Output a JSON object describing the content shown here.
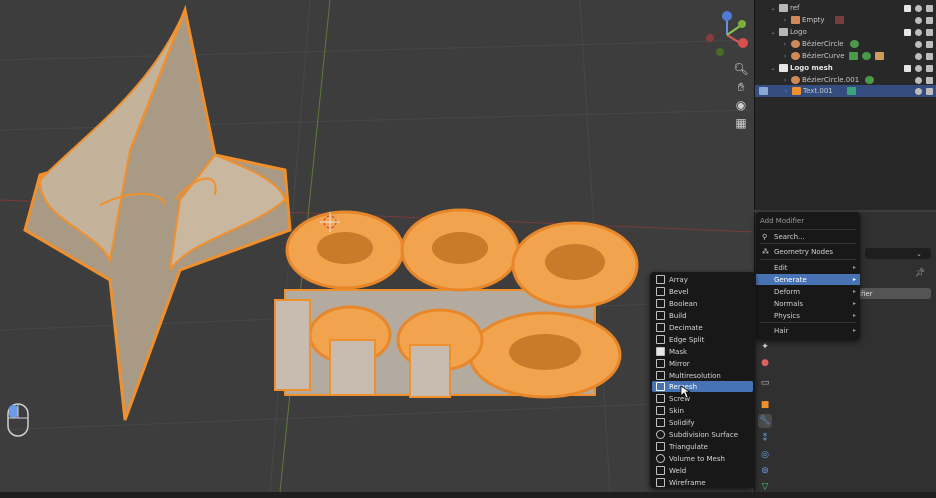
{
  "outliner": {
    "rows": [
      {
        "label": "ref",
        "indent": 0,
        "type": "collection",
        "bold": false,
        "selected": false
      },
      {
        "label": "Empty",
        "indent": 1,
        "type": "empty",
        "bold": false,
        "selected": false
      },
      {
        "label": "Logo",
        "indent": 0,
        "type": "collection",
        "bold": false,
        "selected": false
      },
      {
        "label": "BézierCircle",
        "indent": 1,
        "type": "curve",
        "bold": false,
        "selected": false
      },
      {
        "label": "BézierCurve",
        "indent": 1,
        "type": "curve",
        "bold": false,
        "selected": false
      },
      {
        "label": "Logo mesh",
        "indent": 0,
        "type": "collection",
        "bold": true,
        "selected": false
      },
      {
        "label": "BézierCircle.001",
        "indent": 1,
        "type": "curve",
        "bold": false,
        "selected": false
      },
      {
        "label": "Text.001",
        "indent": 1,
        "type": "text",
        "bold": false,
        "selected": true
      }
    ]
  },
  "add_modifier_menu": {
    "title": "Add Modifier",
    "search_label": "Search...",
    "geometry_nodes_label": "Geometry Nodes",
    "categories": [
      {
        "label": "Edit",
        "highlighted": false
      },
      {
        "label": "Generate",
        "highlighted": true
      },
      {
        "label": "Deform",
        "highlighted": false
      },
      {
        "label": "Normals",
        "highlighted": false
      },
      {
        "label": "Physics",
        "highlighted": false
      },
      {
        "label": "Hair",
        "highlighted": false
      }
    ]
  },
  "generate_menu": {
    "items": [
      {
        "label": "Array",
        "icon": "array-icon",
        "highlighted": false
      },
      {
        "label": "Bevel",
        "icon": "bevel-icon",
        "highlighted": false
      },
      {
        "label": "Boolean",
        "icon": "boolean-icon",
        "highlighted": false
      },
      {
        "label": "Build",
        "icon": "build-icon",
        "highlighted": false
      },
      {
        "label": "Decimate",
        "icon": "decimate-icon",
        "highlighted": false
      },
      {
        "label": "Edge Split",
        "icon": "edge-split-icon",
        "highlighted": false
      },
      {
        "label": "Mask",
        "icon": "mask-icon",
        "highlighted": false
      },
      {
        "label": "Mirror",
        "icon": "mirror-icon",
        "highlighted": false
      },
      {
        "label": "Multiresolution",
        "icon": "multires-icon",
        "highlighted": false
      },
      {
        "label": "Remesh",
        "icon": "remesh-icon",
        "highlighted": true
      },
      {
        "label": "Screw",
        "icon": "screw-icon",
        "highlighted": false
      },
      {
        "label": "Skin",
        "icon": "skin-icon",
        "highlighted": false
      },
      {
        "label": "Solidify",
        "icon": "solidify-icon",
        "highlighted": false
      },
      {
        "label": "Subdivision Surface",
        "icon": "subsurf-icon",
        "highlighted": false
      },
      {
        "label": "Triangulate",
        "icon": "triangulate-icon",
        "highlighted": false
      },
      {
        "label": "Volume to Mesh",
        "icon": "volume-icon",
        "highlighted": false
      },
      {
        "label": "Weld",
        "icon": "weld-icon",
        "highlighted": false
      },
      {
        "label": "Wireframe",
        "icon": "wireframe-icon",
        "highlighted": false
      }
    ]
  },
  "properties": {
    "partial_button_label": "ifier"
  },
  "colors": {
    "selection_orange": "#f0902c",
    "highlight_blue": "#4772b3",
    "outliner_selected": "#334d80"
  }
}
